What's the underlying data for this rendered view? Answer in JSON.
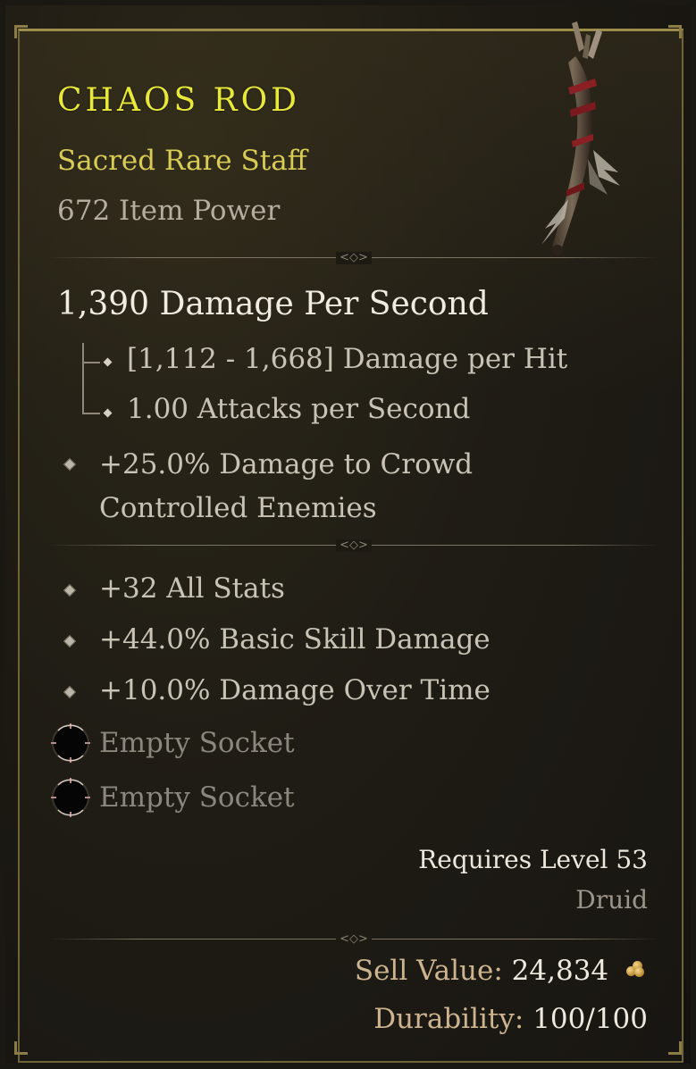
{
  "item": {
    "name": "CHAOS ROD",
    "type_line": "Sacred Rare Staff",
    "item_power": "672 Item Power"
  },
  "weapon": {
    "dps": "1,390 Damage Per Second",
    "damage_per_hit": "[1,112 - 1,668] Damage per Hit",
    "attacks_per_second": "1.00 Attacks per Second"
  },
  "implicit": {
    "line1": "+25.0% Damage to Crowd",
    "line2": "Controlled Enemies"
  },
  "affixes": [
    "+32 All Stats",
    "+44.0% Basic Skill Damage",
    "+10.0% Damage Over Time"
  ],
  "sockets": [
    "Empty Socket",
    "Empty Socket"
  ],
  "requirements": {
    "level": "Requires Level 53",
    "class": "Druid"
  },
  "footer": {
    "sell_label": "Sell Value:",
    "sell_value": "24,834",
    "durability_label": "Durability:",
    "durability_value": "100/100"
  },
  "icons": {
    "item_image": "staff-icon",
    "currency": "gold-coin-icon",
    "socket": "empty-socket-icon",
    "bullet": "diamond-bullet-icon"
  },
  "colors": {
    "rare_name": "#e8e83a",
    "rare_type": "#d8cc55",
    "frame_border": "#9c8e4a"
  }
}
